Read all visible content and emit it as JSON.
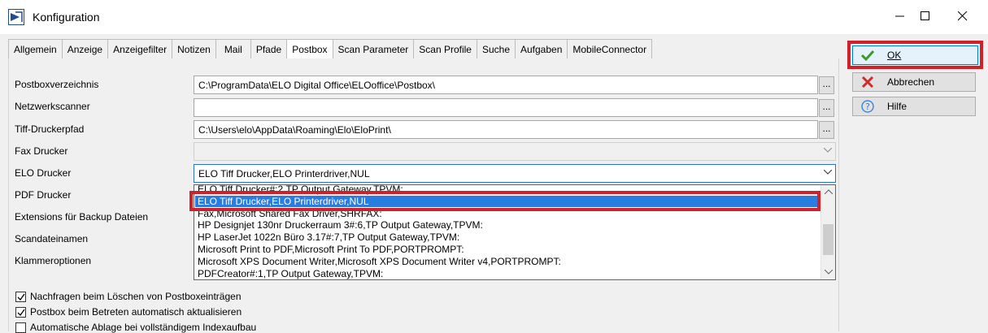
{
  "window": {
    "title": "Konfiguration"
  },
  "tabs": [
    {
      "label": "Allgemein"
    },
    {
      "label": "Anzeige"
    },
    {
      "label": "Anzeigefilter"
    },
    {
      "label": "Notizen"
    },
    {
      "label": "Mail"
    },
    {
      "label": "Pfade"
    },
    {
      "label": "Postbox",
      "active": true
    },
    {
      "label": "Scan Parameter"
    },
    {
      "label": "Scan Profile"
    },
    {
      "label": "Suche"
    },
    {
      "label": "Aufgaben"
    },
    {
      "label": "MobileConnector"
    }
  ],
  "form": {
    "postboxverzeichnis": {
      "label": "Postboxverzeichnis",
      "value": "C:\\ProgramData\\ELO Digital Office\\ELOoffice\\Postbox\\"
    },
    "netzwerkscanner": {
      "label": "Netzwerkscanner",
      "value": ""
    },
    "tiff_druckerpfad": {
      "label": "Tiff-Druckerpfad",
      "value": "C:\\Users\\elo\\AppData\\Roaming\\Elo\\EloPrint\\"
    },
    "fax_drucker": {
      "label": "Fax Drucker",
      "value": ""
    },
    "elo_drucker": {
      "label": "ELO Drucker",
      "value": "ELO Tiff Drucker,ELO Printerdriver,NUL"
    },
    "pdf_drucker": {
      "label": "PDF Drucker"
    },
    "extensions": {
      "label": "Extensions für Backup Dateien"
    },
    "scandateinamen": {
      "label": "Scandateinamen"
    },
    "klammeroptionen": {
      "label": "Klammeroptionen"
    },
    "browse_label": "..."
  },
  "dropdown_options": [
    "ELO Tiff Drucker#:2,TP Output Gateway,TPVM:",
    "ELO Tiff Drucker,ELO Printerdriver,NUL",
    "Fax,Microsoft Shared Fax Driver,SHRFAX:",
    "HP Designjet 130nr Druckerraum 3#:6,TP Output Gateway,TPVM:",
    "HP LaserJet 1022n Büro 3.17#:7,TP Output Gateway,TPVM:",
    "Microsoft Print to PDF,Microsoft Print To PDF,PORTPROMPT:",
    "Microsoft XPS Document Writer,Microsoft XPS Document Writer v4,PORTPROMPT:",
    "PDFCreator#:1,TP Output Gateway,TPVM:"
  ],
  "checkboxes": [
    {
      "label": "Nachfragen beim Löschen von Postboxeinträgen",
      "checked": true
    },
    {
      "label": "Postbox beim Betreten automatisch aktualisieren",
      "checked": true
    },
    {
      "label": "Automatische Ablage bei vollständigem Indexaufbau",
      "checked": false
    }
  ],
  "buttons": {
    "ok": "OK",
    "abbrechen": "Abbrechen",
    "hilfe": "Hilfe"
  },
  "colors": {
    "highlight_frame": "#d0202a",
    "selection": "#2a7de0",
    "ok_icon": "#3c9a2c",
    "cancel_icon": "#d12a2a"
  }
}
